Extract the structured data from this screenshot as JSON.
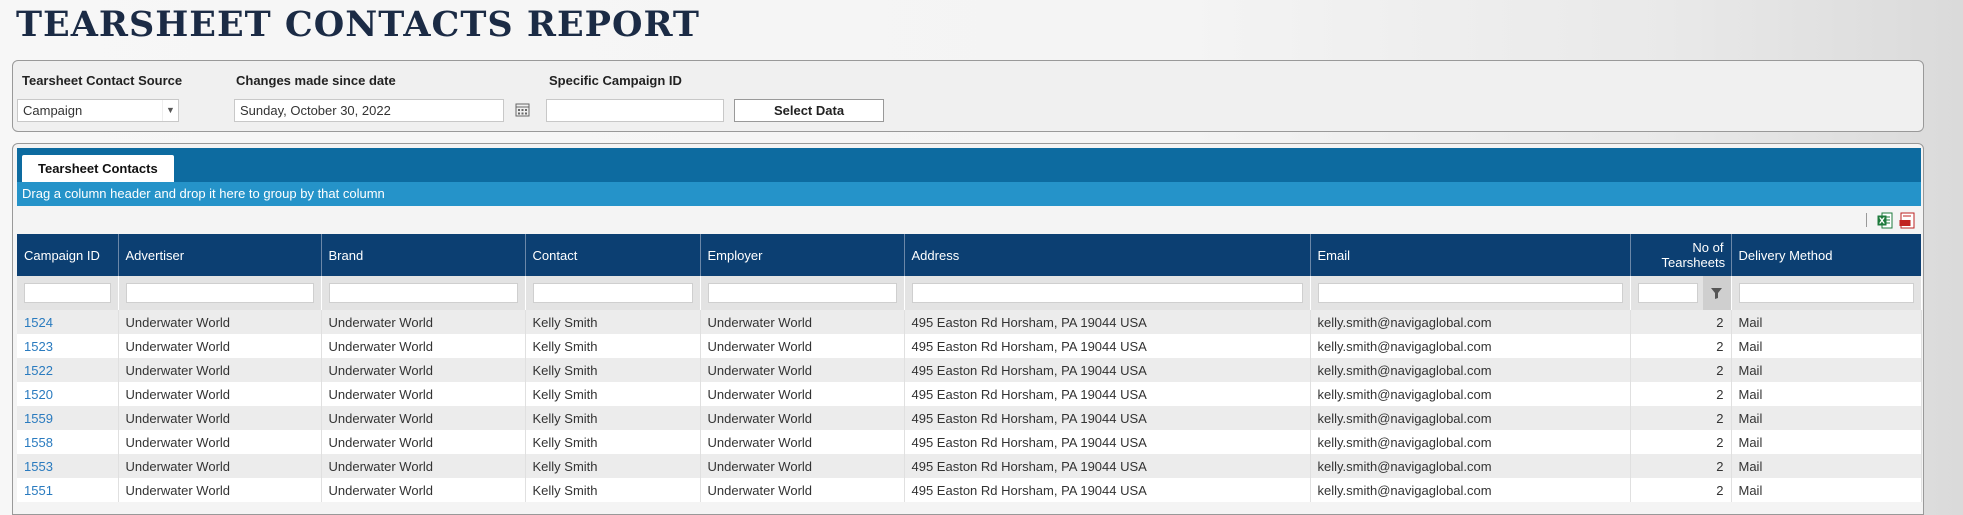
{
  "page": {
    "title": "TEARSHEET CONTACTS REPORT"
  },
  "filters": {
    "source_label": "Tearsheet Contact Source",
    "source_value": "Campaign",
    "date_label": "Changes made since date",
    "date_value": "Sunday, October 30, 2022",
    "campaign_label": "Specific Campaign ID",
    "campaign_value": "",
    "select_button": "Select Data"
  },
  "tab": {
    "label": "Tearsheet Contacts"
  },
  "group_bar": {
    "text": "Drag a column header and drop it here to group by that column"
  },
  "toolbar": {
    "icons": [
      "excel-export-icon",
      "pdf-export-icon"
    ]
  },
  "table": {
    "columns": [
      "Campaign ID",
      "Advertiser",
      "Brand",
      "Contact",
      "Employer",
      "Address",
      "Email",
      "No of Tearsheets",
      "Delivery Method"
    ],
    "rows": [
      [
        "1524",
        "Underwater World",
        "Underwater World",
        "Kelly Smith",
        "Underwater World",
        "495 Easton Rd Horsham, PA 19044 USA",
        "kelly.smith@navigaglobal.com",
        "2",
        "Mail"
      ],
      [
        "1523",
        "Underwater World",
        "Underwater World",
        "Kelly Smith",
        "Underwater World",
        "495 Easton Rd Horsham, PA 19044 USA",
        "kelly.smith@navigaglobal.com",
        "2",
        "Mail"
      ],
      [
        "1522",
        "Underwater World",
        "Underwater World",
        "Kelly Smith",
        "Underwater World",
        "495 Easton Rd Horsham, PA 19044 USA",
        "kelly.smith@navigaglobal.com",
        "2",
        "Mail"
      ],
      [
        "1520",
        "Underwater World",
        "Underwater World",
        "Kelly Smith",
        "Underwater World",
        "495 Easton Rd Horsham, PA 19044 USA",
        "kelly.smith@navigaglobal.com",
        "2",
        "Mail"
      ],
      [
        "1559",
        "Underwater World",
        "Underwater World",
        "Kelly Smith",
        "Underwater World",
        "495 Easton Rd Horsham, PA 19044 USA",
        "kelly.smith@navigaglobal.com",
        "2",
        "Mail"
      ],
      [
        "1558",
        "Underwater World",
        "Underwater World",
        "Kelly Smith",
        "Underwater World",
        "495 Easton Rd Horsham, PA 19044 USA",
        "kelly.smith@navigaglobal.com",
        "2",
        "Mail"
      ],
      [
        "1553",
        "Underwater World",
        "Underwater World",
        "Kelly Smith",
        "Underwater World",
        "495 Easton Rd Horsham, PA 19044 USA",
        "kelly.smith@navigaglobal.com",
        "2",
        "Mail"
      ],
      [
        "1551",
        "Underwater World",
        "Underwater World",
        "Kelly Smith",
        "Underwater World",
        "495 Easton Rd Horsham, PA 19044 USA",
        "kelly.smith@navigaglobal.com",
        "2",
        "Mail"
      ]
    ]
  },
  "colors": {
    "header": "#0c3f72",
    "tab_strip": "#0d6ba0",
    "group_bar": "#2593c9",
    "link": "#2a7bbf",
    "title": "#1b2b45"
  }
}
